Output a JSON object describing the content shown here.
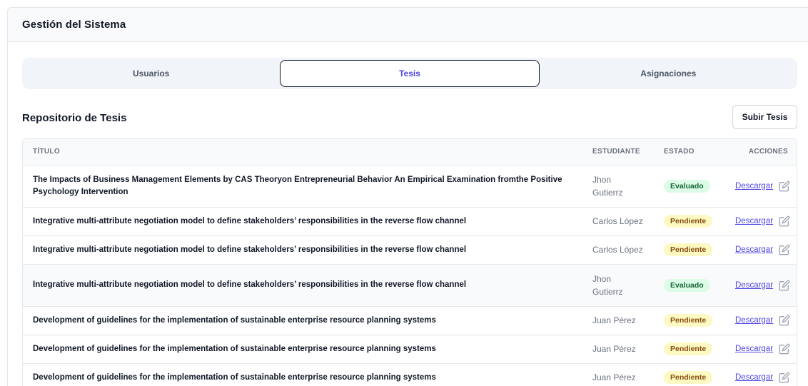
{
  "header": {
    "title": "Gestión del Sistema"
  },
  "tabs": [
    {
      "label": "Usuarios",
      "active": false
    },
    {
      "label": "Tesis",
      "active": true
    },
    {
      "label": "Asignaciones",
      "active": false
    }
  ],
  "repository": {
    "title": "Repositorio de Tesis",
    "upload_label": "Subir Tesis"
  },
  "table": {
    "columns": {
      "title": "TÍTULO",
      "student": "ESTUDIANTE",
      "status": "ESTADO",
      "actions": "ACCIONES"
    },
    "download_label": "Descargar",
    "edit_icon": "edit-icon",
    "rows": [
      {
        "title": "The Impacts of Business Management Elements by CAS Theoryon Entrepreneurial Behavior An Empirical Examination fromthe Positive Psychology Intervention",
        "student": "Jhon Gutierrz",
        "status": "Evaluado",
        "download": "Descargar"
      },
      {
        "title": "Integrative multi-attribute negotiation model to define stakeholders’ responsibilities in the reverse flow channel",
        "student": "Carlos López",
        "status": "Pendiente",
        "download": "Descargar"
      },
      {
        "title": "Integrative multi-attribute negotiation model to define stakeholders’ responsibilities in the reverse flow channel",
        "student": "Carlos López",
        "status": "Pendiente",
        "download": "Descargar"
      },
      {
        "title": "Integrative multi-attribute negotiation model to define stakeholders’ responsibilities in the reverse flow channel",
        "student": "Jhon Gutierrz",
        "status": "Evaluado",
        "download": "Descargar"
      },
      {
        "title": "Development of guidelines for the implementation of sustainable enterprise resource planning systems",
        "student": "Juan Pérez",
        "status": "Pendiente",
        "download": "Descargar"
      },
      {
        "title": "Development of guidelines for the implementation of sustainable enterprise resource planning systems",
        "student": "Juan Pérez",
        "status": "Pendiente",
        "download": "Descargar"
      },
      {
        "title": "Development of guidelines for the implementation of sustainable enterprise resource planning systems",
        "student": "Juan Pérez",
        "status": "Pendiente",
        "download": "Descargar"
      }
    ]
  },
  "colors": {
    "accent": "#4f46e5",
    "evaluado_bg": "#dcfce7",
    "evaluado_text": "#166534",
    "pendiente_bg": "#fef9c3",
    "pendiente_text": "#854d0e"
  }
}
